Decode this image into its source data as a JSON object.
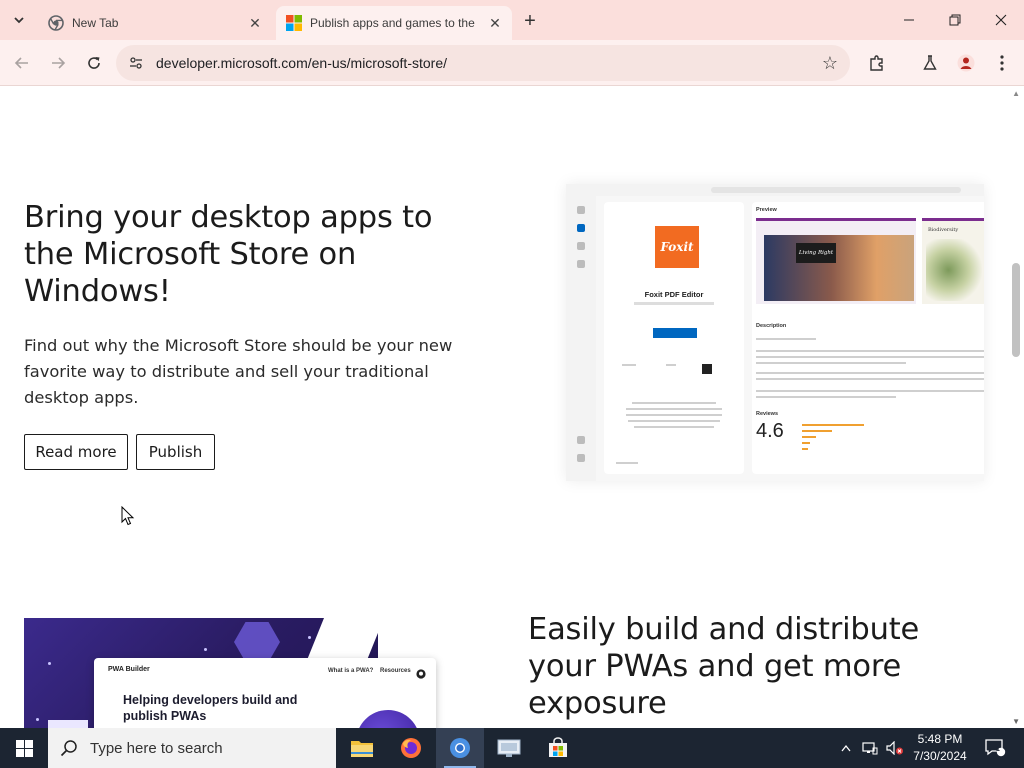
{
  "browser": {
    "tabs": [
      {
        "title": "New Tab",
        "favicon": "chrome-icon",
        "active": false
      },
      {
        "title": "Publish apps and games to the",
        "favicon": "microsoft-logo",
        "active": true
      }
    ],
    "url": "developer.microsoft.com/en-us/microsoft-store/"
  },
  "page": {
    "hero": {
      "title": "Bring your desktop apps to the Microsoft Store on Windows!",
      "description": "Find out why the Microsoft Store should be your new favorite way to distribute and sell your traditional desktop apps.",
      "read_more_label": "Read more",
      "publish_label": "Publish"
    },
    "store_preview": {
      "app_name": "Foxit PDF Editor",
      "logo_text": "Foxit",
      "section_preview": "Preview",
      "section_description": "Description",
      "section_reviews": "Reviews",
      "rating": "4.6",
      "banner_text": "Living Right",
      "side_tile_text": "Biodiversity"
    },
    "pwa": {
      "logo_text": "PWA Builder",
      "nav_items": [
        "What is a PWA?",
        "Resources"
      ],
      "card_headline": "Helping developers build and publish PWAs",
      "title": "Easily build and distribute your PWAs and get more exposure"
    }
  },
  "taskbar": {
    "search_placeholder": "Type here to search",
    "apps": [
      "file-explorer-icon",
      "firefox-icon",
      "chrome-icon",
      "remote-desktop-icon",
      "microsoft-store-icon"
    ],
    "time": "5:48 PM",
    "date": "7/30/2024",
    "notification_count": "1"
  },
  "colors": {
    "tabstrip": "#fbdfdc",
    "toolbar": "#fdf0ef",
    "taskbar": "#1c2532",
    "foxit_orange": "#f26b21",
    "store_blue": "#0067c0"
  }
}
